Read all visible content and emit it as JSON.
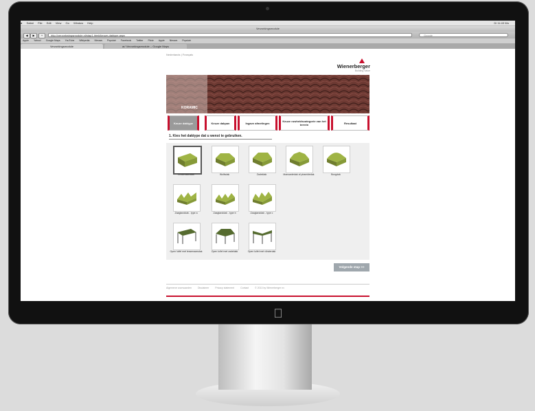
{
  "menubar": {
    "items": [
      "Safari",
      "File",
      "Edit",
      "View",
      "Go",
      "Window",
      "Help"
    ],
    "status": "Di 11:49 Wu"
  },
  "window": {
    "title": "Verzorkingsmodule"
  },
  "toolbar": {
    "back": "◀",
    "forward": "▶",
    "add": "+",
    "url": "http://verzorkwingsmodule.nl/stap1.html#keuze-daktype.aspx",
    "search_placeholder": "Google"
  },
  "bookmarks": [
    "Apple",
    "Yahoo!",
    "Google Maps",
    "YouTube",
    "Wikipedia",
    "Nieuws",
    "Populair",
    "Facebook",
    "Twitter",
    "Flickr",
    "Apple",
    "Nieuws",
    "Populair"
  ],
  "tabs": [
    {
      "label": "Verzorkingsmodule"
    },
    {
      "label": "ar/ Verzorkingsmodule – Google Maps"
    }
  ],
  "page": {
    "lang": "Nederlands | Français",
    "brand": {
      "name": "Wienerberger",
      "sub": "Building Value"
    },
    "hero_logo": "KORAMIC",
    "steps": [
      {
        "label": "Keuze daktype",
        "active": true
      },
      {
        "label": "Keuze dakpan",
        "active": false
      },
      {
        "label": "Ingave afmetingen",
        "active": false
      },
      {
        "label": "Keuze ruwheidscategorie van het terrein",
        "active": false
      },
      {
        "label": "Resultaat",
        "active": false
      }
    ],
    "heading": "1. Kies het daktype dat u wenst te gebruiken.",
    "roof_types": [
      {
        "label": "Lessenaarsdak",
        "selected": true
      },
      {
        "label": "Wolfsdak"
      },
      {
        "label": "Zadeldak"
      },
      {
        "label": "Mansardedak of piramidedak"
      },
      {
        "label": "Boogdak"
      },
      {
        "label": "Zaagtanddak - type a"
      },
      {
        "label": "Zaagtanddak - type b"
      },
      {
        "label": "Zaagtanddak - type c"
      },
      {
        "label": "Open luifel met lessenaarsdak"
      },
      {
        "label": "Open luifel met zadeldak"
      },
      {
        "label": "Open luifel met vlinderdak"
      }
    ],
    "next_button": "Volgende stap >>",
    "footer": [
      "Algemene voorwaarden",
      "Disclaimer",
      "Privacy statement",
      "Contact",
      "© 2013 by Wienerberger nv"
    ]
  },
  "colors": {
    "brand_red": "#c8102e",
    "roof_green": "#a7b94a"
  }
}
